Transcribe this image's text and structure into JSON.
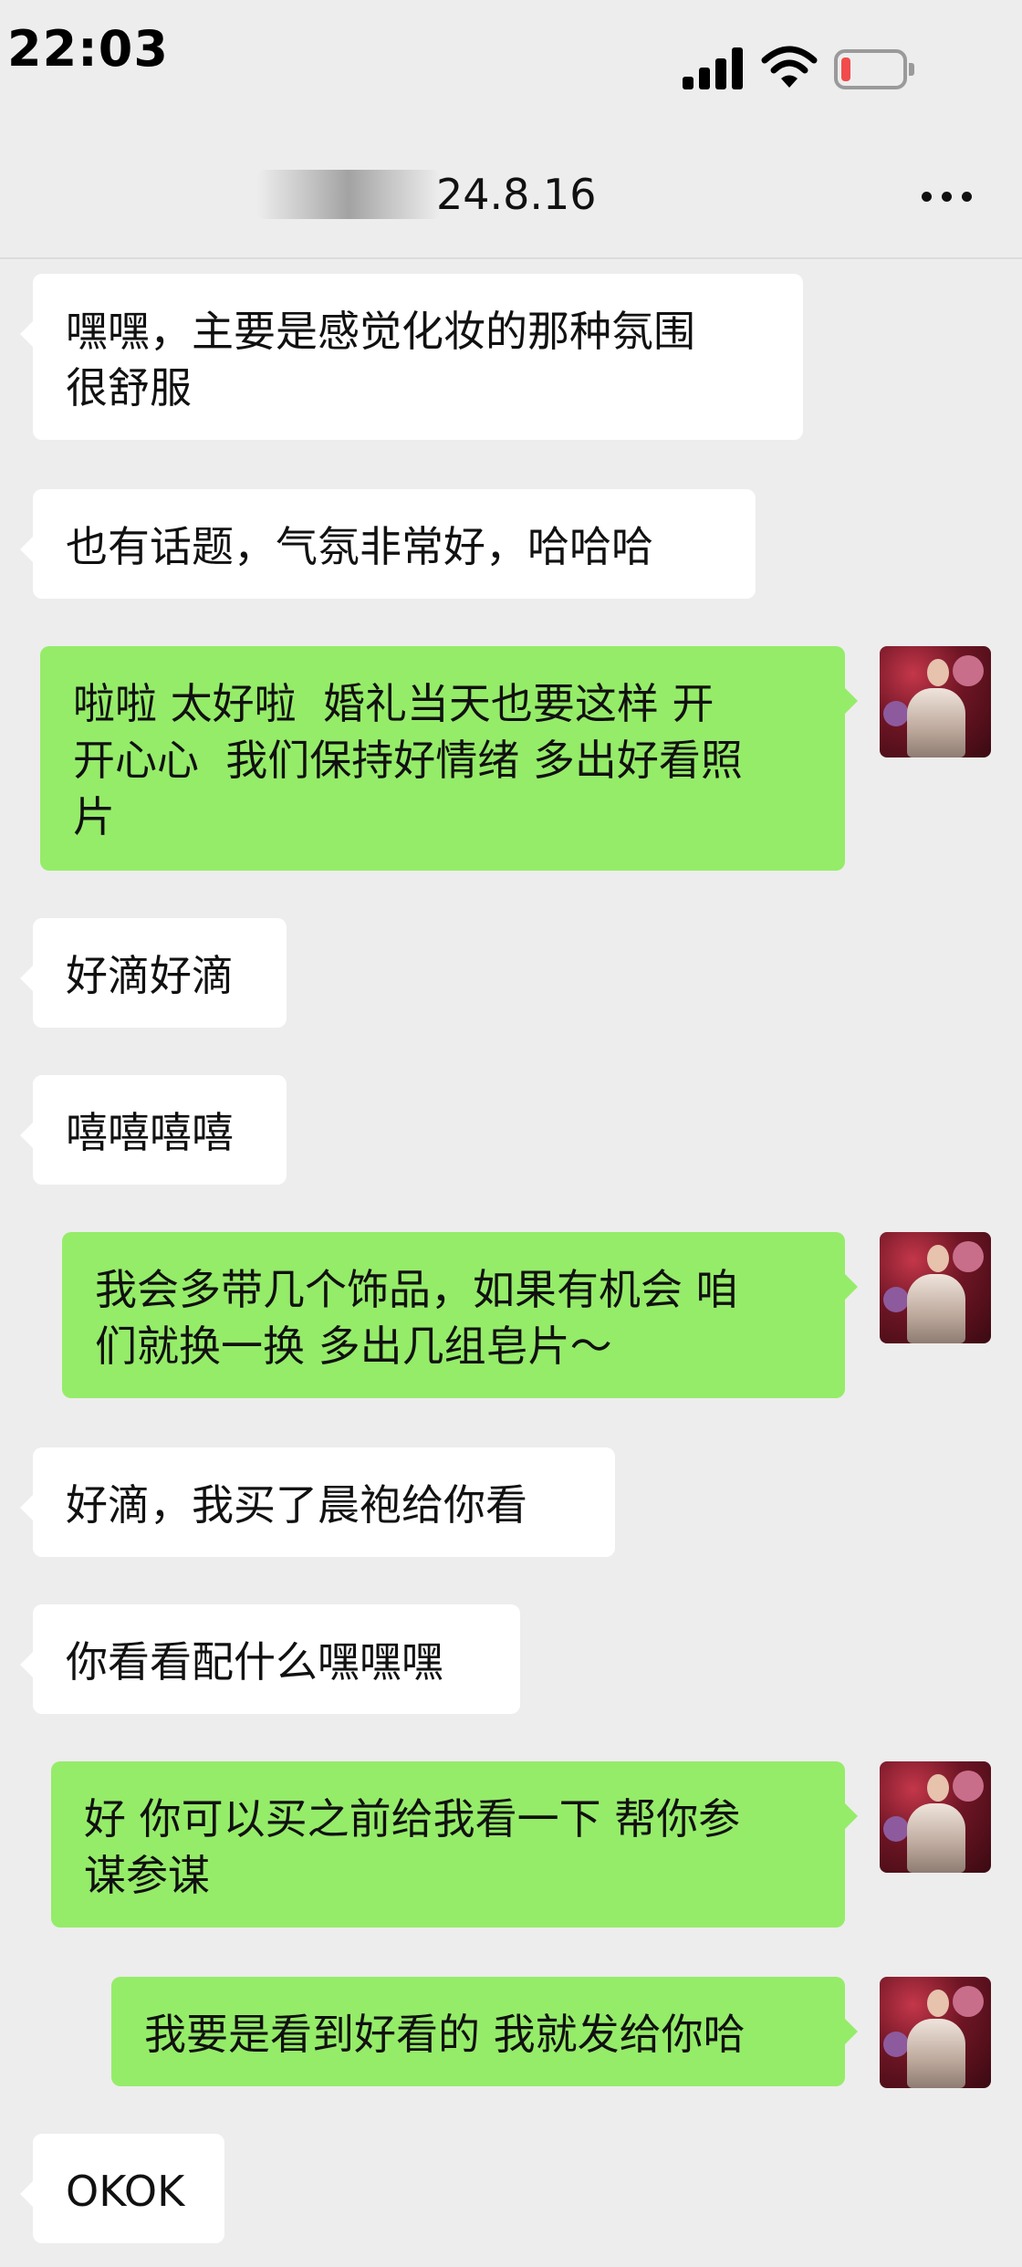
{
  "status_bar": {
    "time": "22:03"
  },
  "header": {
    "title": "24.8.16"
  },
  "colors": {
    "background": "#ededed",
    "bubble_self": "#95ec69",
    "bubble_other": "#ffffff",
    "battery_low": "#f14b4b"
  },
  "messages": [
    {
      "side": "left",
      "text": "嘿嘿，主要是感觉化妆的那种氛围\n很舒服"
    },
    {
      "side": "left",
      "text": "也有话题，气氛非常好，哈哈哈"
    },
    {
      "side": "right",
      "text": "啦啦 太好啦  婚礼当天也要这样 开\n开心心  我们保持好情绪 多出好看照\n片"
    },
    {
      "side": "left",
      "text": "好滴好滴"
    },
    {
      "side": "left",
      "text": "嘻嘻嘻嘻"
    },
    {
      "side": "right",
      "text": "我会多带几个饰品，如果有机会 咱\n们就换一换 多出几组皂片～"
    },
    {
      "side": "left",
      "text": "好滴，我买了晨袍给你看"
    },
    {
      "side": "left",
      "text": "你看看配什么嘿嘿嘿"
    },
    {
      "side": "right",
      "text": "好 你可以买之前给我看一下 帮你参\n谋参谋"
    },
    {
      "side": "right",
      "text": "我要是看到好看的 我就发给你哈"
    },
    {
      "side": "left",
      "text": "OKOK"
    }
  ]
}
